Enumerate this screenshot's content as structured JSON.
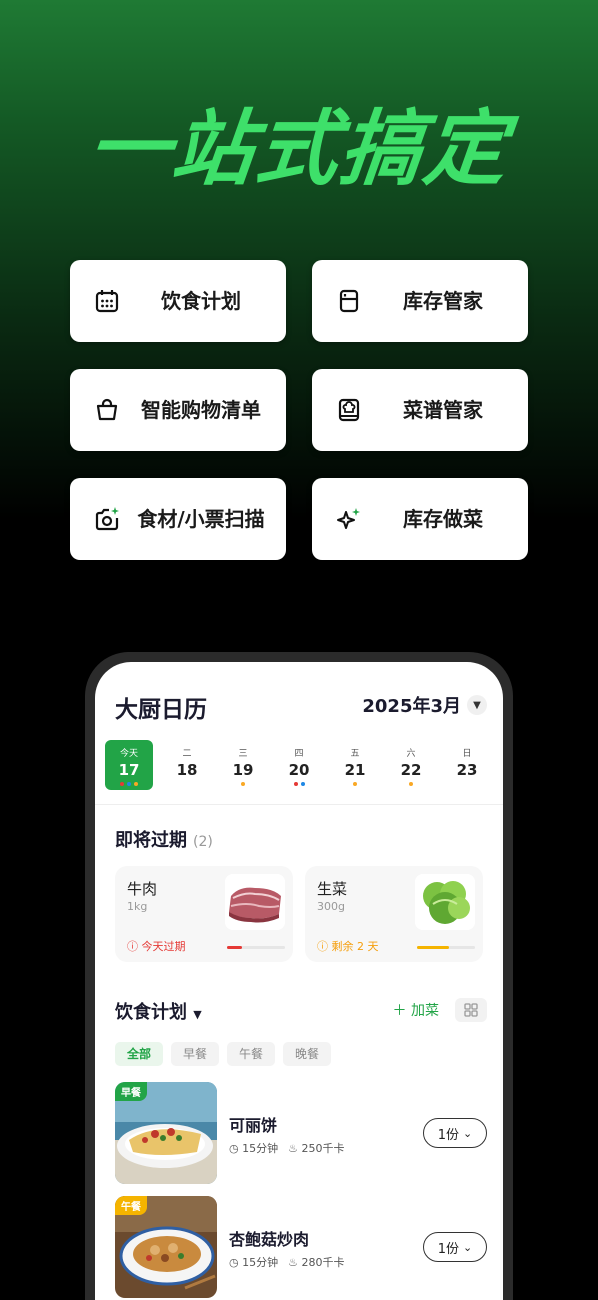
{
  "headline": "一站式搞定",
  "features": [
    {
      "label": "饮食计划",
      "icon": "calendar-icon"
    },
    {
      "label": "库存管家",
      "icon": "fridge-icon"
    },
    {
      "label": "智能购物清单",
      "icon": "shopping-bag-icon"
    },
    {
      "label": "菜谱管家",
      "icon": "recipe-book-icon"
    },
    {
      "label": "食材/小票扫描",
      "icon": "camera-scan-icon"
    },
    {
      "label": "库存做菜",
      "icon": "sparkle-icon"
    }
  ],
  "app": {
    "title": "大厨日历",
    "month": "2025年3月"
  },
  "week": [
    {
      "name": "今天",
      "num": "17",
      "today": true,
      "dots": [
        "#e53935",
        "#1e88e5",
        "#f9a825"
      ]
    },
    {
      "name": "二",
      "num": "18",
      "dots": []
    },
    {
      "name": "三",
      "num": "19",
      "dots": [
        "#f9a825"
      ]
    },
    {
      "name": "四",
      "num": "20",
      "dots": [
        "#e53935",
        "#1e88e5"
      ]
    },
    {
      "name": "五",
      "num": "21",
      "dots": [
        "#f9a825"
      ]
    },
    {
      "name": "六",
      "num": "22",
      "dots": [
        "#f9a825"
      ]
    },
    {
      "name": "日",
      "num": "23",
      "dots": []
    }
  ],
  "expiring": {
    "title": "即将过期",
    "count": "(2)",
    "items": [
      {
        "name": "牛肉",
        "qty": "1kg",
        "status": "今天过期",
        "status_color": "#e53935",
        "remaining": 0.25
      },
      {
        "name": "生菜",
        "qty": "300g",
        "status": "剩余 2 天",
        "status_color": "#f59e0b",
        "remaining": 0.55
      }
    ]
  },
  "plan": {
    "title": "饮食计划",
    "add_label": "加菜",
    "filters": [
      "全部",
      "早餐",
      "午餐",
      "晚餐"
    ],
    "meals": [
      {
        "tag": "早餐",
        "tag_color": "#22a447",
        "name": "可丽饼",
        "time": "15分钟",
        "cal": "250千卡",
        "portion": "1份"
      },
      {
        "tag": "午餐",
        "tag_color": "#f5b400",
        "name": "杏鲍菇炒肉",
        "time": "15分钟",
        "cal": "280千卡",
        "portion": "1份"
      }
    ]
  },
  "colors": {
    "accent": "#22a447",
    "headline": "#3ee06a"
  }
}
